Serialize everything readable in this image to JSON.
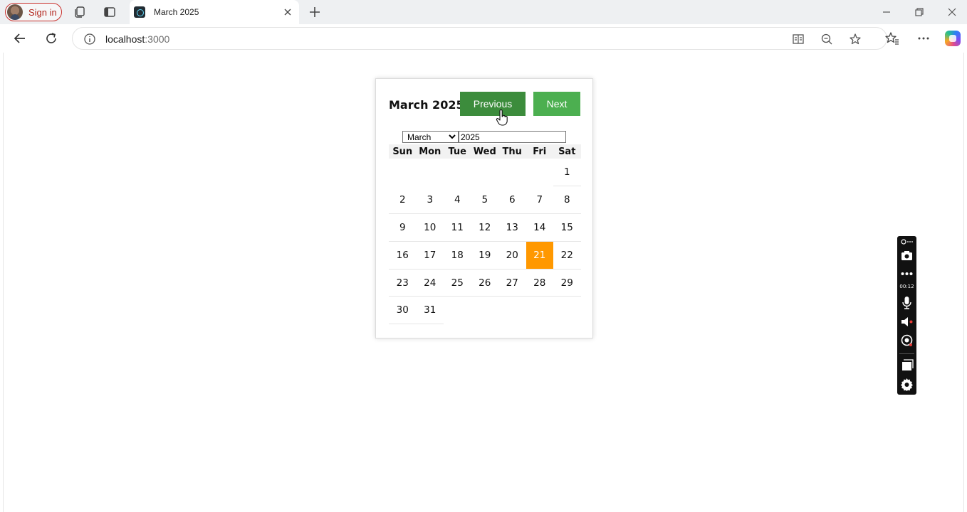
{
  "browser": {
    "signin_label": "Sign in",
    "tab_title": "March 2025",
    "url_host": "localhost",
    "url_port": ":3000",
    "icons": [
      "workspaces-icon",
      "tab-actions-icon",
      "close-tab-icon",
      "new-tab-icon",
      "minimize-icon",
      "restore-icon",
      "close-window-icon",
      "back-icon",
      "refresh-icon",
      "site-info-icon",
      "immersive-reader-icon",
      "zoom-out-icon",
      "favorite-star-icon",
      "favorites-icon",
      "more-icon",
      "copilot-icon"
    ]
  },
  "calendar": {
    "title": "March 2025",
    "prev_label": "Previous",
    "next_label": "Next",
    "month_value": "March",
    "year_value": "2025",
    "weekdays": [
      "Sun",
      "Mon",
      "Tue",
      "Wed",
      "Thu",
      "Fri",
      "Sat"
    ],
    "weeks": [
      [
        "",
        "",
        "",
        "",
        "",
        "",
        "1"
      ],
      [
        "2",
        "3",
        "4",
        "5",
        "6",
        "7",
        "8"
      ],
      [
        "9",
        "10",
        "11",
        "12",
        "13",
        "14",
        "15"
      ],
      [
        "16",
        "17",
        "18",
        "19",
        "20",
        "21",
        "22"
      ],
      [
        "23",
        "24",
        "25",
        "26",
        "27",
        "28",
        "29"
      ],
      [
        "30",
        "31",
        "",
        "",
        "",
        "",
        ""
      ]
    ],
    "highlighted_day": "21",
    "colors": {
      "prev_button": "#3c8c3c",
      "next_button": "#4caf50",
      "highlight": "#ff9800"
    }
  },
  "recorder": {
    "timer": "00:12",
    "icons": [
      "recorder-menu-icon",
      "camera-icon",
      "more-dots-icon",
      "microphone-icon",
      "speaker-icon",
      "webcam-icon",
      "window-icon",
      "settings-gear-icon"
    ]
  }
}
